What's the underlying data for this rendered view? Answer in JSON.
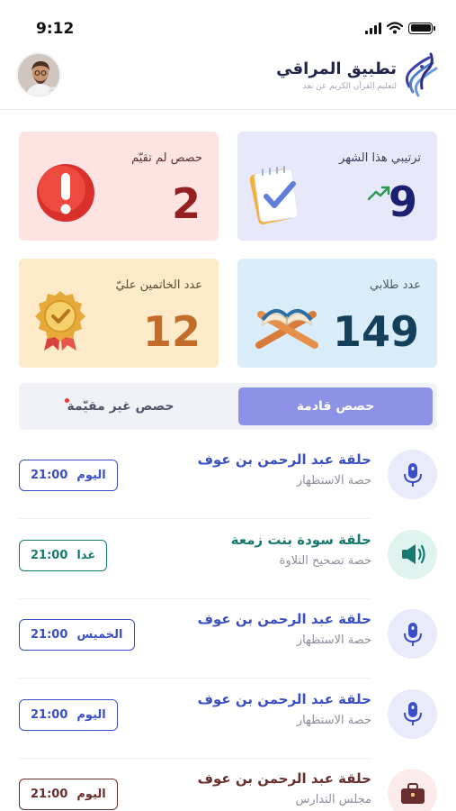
{
  "status_bar": {
    "time": "9:12"
  },
  "app": {
    "name": "تطبيق المراقي",
    "tagline": "لتعليم القرآن الكريم عن بعد"
  },
  "stats": {
    "rank": {
      "label": "ترتيبي هذا الشهر",
      "value": "9"
    },
    "missed": {
      "label": "حصص لم تقيّم",
      "value": "2"
    },
    "students": {
      "label": "عدد طلابي",
      "value": "149"
    },
    "khatm": {
      "label": "عدد الخاتمين عليّ",
      "value": "12"
    }
  },
  "tabs": [
    {
      "label": "حصص قادمة",
      "active": true
    },
    {
      "label": "حصص غير مقيّمة",
      "active": false,
      "has_dot": true
    }
  ],
  "sessions": [
    {
      "title": "حلقة عبد الرحمن بن عوف",
      "subtitle": "حصة الاستظهار",
      "day": "اليوم",
      "time": "21:00",
      "icon": "microphone-icon",
      "accent": "#3a4fc4",
      "icon_bg": "#e9ebfb"
    },
    {
      "title": "حلقة سودة بنت زمعة",
      "subtitle": "حصة تصحيح التلاوة",
      "day": "غدا",
      "time": "21:00",
      "icon": "speaker-icon",
      "accent": "#167a70",
      "icon_bg": "#dff4ee"
    },
    {
      "title": "حلقة عبد الرحمن بن عوف",
      "subtitle": "حصة الاستظهار",
      "day": "الخميس",
      "time": "21:00",
      "icon": "microphone-icon",
      "accent": "#3a4fc4",
      "icon_bg": "#e9ebfb"
    },
    {
      "title": "حلقة عبد الرحمن بن عوف",
      "subtitle": "حصة الاستظهار",
      "day": "اليوم",
      "time": "21:00",
      "icon": "microphone-icon",
      "accent": "#3a4fc4",
      "icon_bg": "#e9ebfb"
    },
    {
      "title": "حلقة عبد الرحمن بن عوف",
      "subtitle": "مجلس التدارس",
      "day": "اليوم",
      "time": "21:00",
      "icon": "briefcase-icon",
      "accent": "#6a2d2d",
      "icon_bg": "#fbeceb"
    }
  ]
}
